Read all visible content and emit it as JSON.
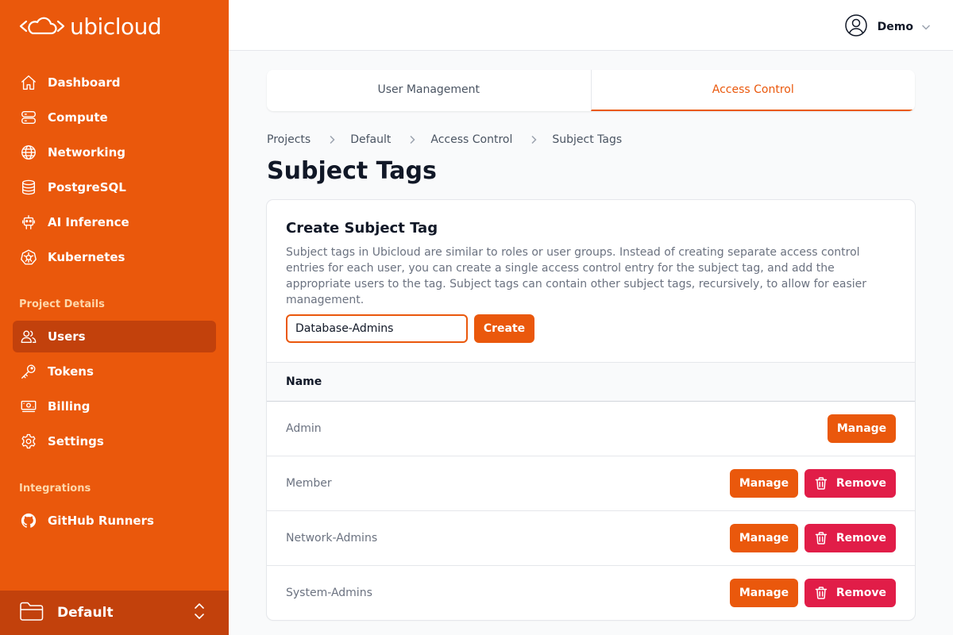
{
  "brand": {
    "name": "ubicloud"
  },
  "sidebar": {
    "main_items": [
      {
        "label": "Dashboard",
        "icon": "home-icon"
      },
      {
        "label": "Compute",
        "icon": "server-icon"
      },
      {
        "label": "Networking",
        "icon": "globe-icon"
      },
      {
        "label": "PostgreSQL",
        "icon": "database-icon"
      },
      {
        "label": "AI Inference",
        "icon": "robot-icon"
      },
      {
        "label": "Kubernetes",
        "icon": "helm-icon"
      }
    ],
    "project_section_title": "Project Details",
    "project_items": [
      {
        "label": "Users",
        "icon": "users-icon",
        "active": true
      },
      {
        "label": "Tokens",
        "icon": "key-icon"
      },
      {
        "label": "Billing",
        "icon": "banknote-icon"
      },
      {
        "label": "Settings",
        "icon": "gear-icon"
      }
    ],
    "integrations_section_title": "Integrations",
    "integration_items": [
      {
        "label": "GitHub Runners",
        "icon": "github-icon"
      }
    ],
    "project_switcher": {
      "name": "Default"
    }
  },
  "header": {
    "user_name": "Demo"
  },
  "tabs": [
    {
      "label": "User Management",
      "active": false
    },
    {
      "label": "Access Control",
      "active": true
    }
  ],
  "breadcrumb": [
    "Projects",
    "Default",
    "Access Control",
    "Subject Tags"
  ],
  "page_title": "Subject Tags",
  "create": {
    "title": "Create Subject Tag",
    "description": "Subject tags in Ubicloud are similar to roles or user groups. Instead of creating separate access control entries for each user, you can create a single access control entry for the subject tag, and add the appropriate users to the tag. Subject tags can contain other subject tags, recursively, to allow for easier management.",
    "input_value": "Database-Admins",
    "button_label": "Create"
  },
  "table": {
    "header_name": "Name",
    "manage_label": "Manage",
    "remove_label": "Remove",
    "rows": [
      {
        "name": "Admin",
        "removable": false
      },
      {
        "name": "Member",
        "removable": true
      },
      {
        "name": "Network-Admins",
        "removable": true
      },
      {
        "name": "System-Admins",
        "removable": true
      }
    ]
  },
  "colors": {
    "brand": "#ea580c",
    "brand_dark": "#c2410c",
    "danger": "#e11d48"
  }
}
